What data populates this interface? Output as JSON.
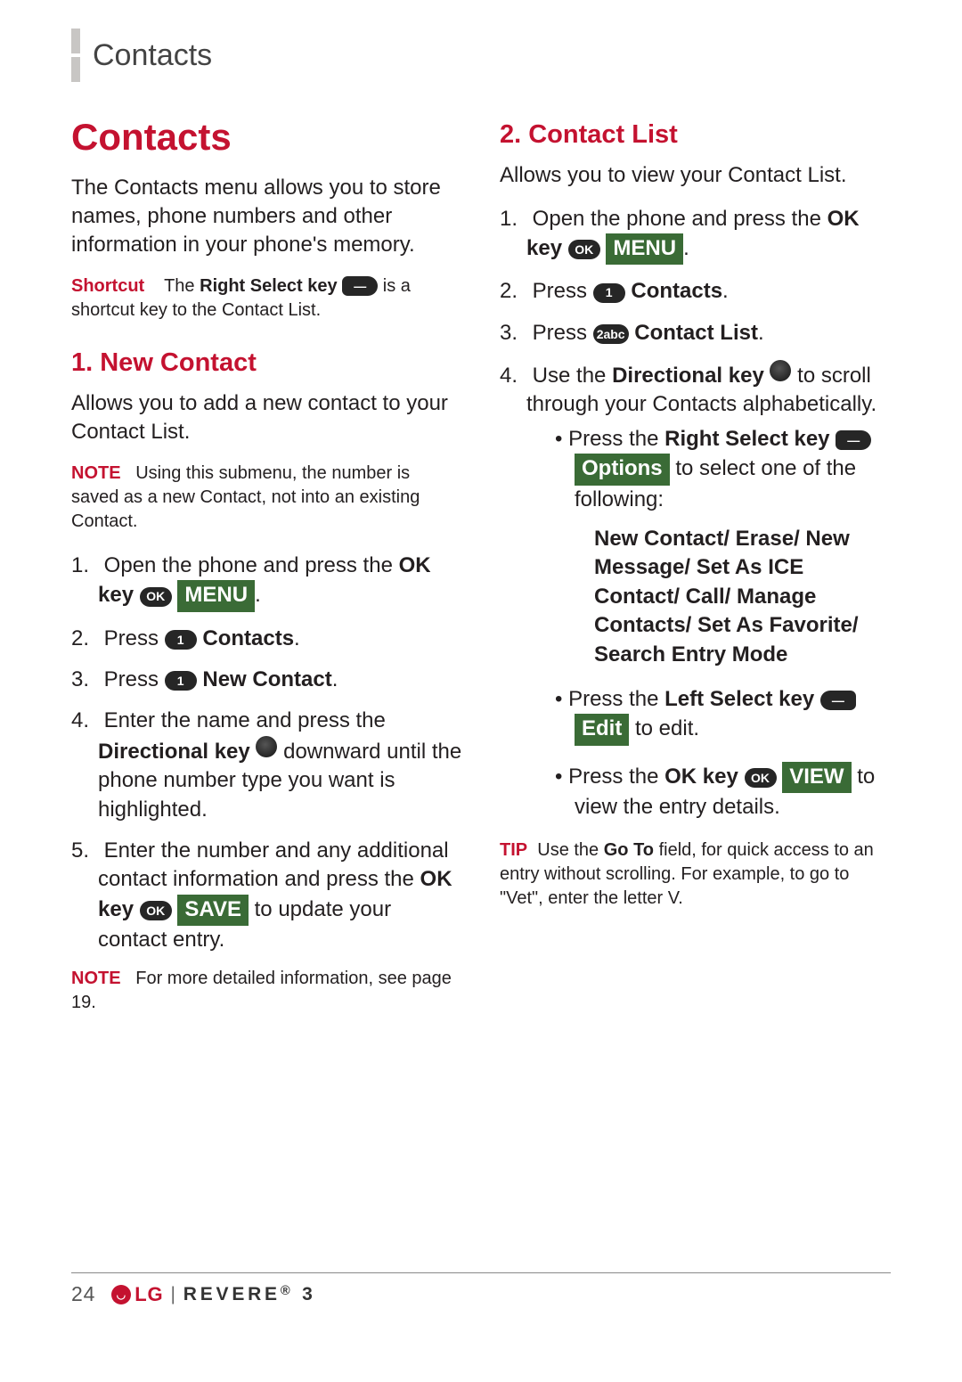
{
  "header": {
    "section": "Contacts"
  },
  "left": {
    "title": "Contacts",
    "intro": "The Contacts menu allows you to store names, phone numbers and other information in your phone's memory.",
    "shortcut_label": "Shortcut",
    "shortcut_a": "The ",
    "shortcut_b": "Right Select key",
    "shortcut_c": " is a shortcut key to the Contact List.",
    "h1": "1. New Contact",
    "h1_intro": "Allows you to add a new contact to your Contact List.",
    "note1_label": "NOTE",
    "note1": "Using this submenu, the number is saved as a new Contact, not into an existing Contact.",
    "s1a": "Open the phone and press the ",
    "ok_key": "OK key",
    "menu_label": "MENU",
    "s2a": "Press ",
    "contacts_label": "Contacts",
    "s3a": "Press ",
    "newcontact_label": "New Contact",
    "s4a": "Enter the name and press the ",
    "dir_key": "Directional key",
    "s4b": " downward until the phone number type you want is highlighted.",
    "s5a": "Enter the number and any additional contact information and press the ",
    "save_label": "SAVE",
    "s5b": " to update your contact entry.",
    "note2_label": "NOTE",
    "note2": "For more detailed information, see page 19."
  },
  "right": {
    "h2": "2. Contact List",
    "intro": "Allows you to view your Contact List.",
    "s1a": "Open the phone and press the ",
    "s2a": "Press ",
    "contacts_label": "Contacts",
    "s3a": "Press ",
    "contactlist_label": "Contact List",
    "s4a": "Use the ",
    "s4b": " to scroll through your Contacts alphabetically.",
    "b1a": "Press the ",
    "b1key": "Right Select key",
    "options_label": "Options",
    "b1b": " to select one of the following:",
    "options_block": "New Contact/ Erase/ New Message/ Set As ICE Contact/ Call/  Manage Contacts/ Set As Favorite/ Search Entry Mode",
    "b2a": "Press the ",
    "b2key": "Left Select key",
    "edit_label": "Edit",
    "b2b": " to edit.",
    "b3a": "Press the ",
    "b3key": "OK key",
    "view_label": "VIEW",
    "b3b": " to view the entry details.",
    "tip_label": "TIP",
    "tip_a": "Use the ",
    "tip_b": "Go To",
    "tip_c": " field, for quick access to an entry without scrolling. For example, to go to \"Vet\", enter the letter V."
  },
  "icons": {
    "ok": "OK",
    "one": "1",
    "two": "2abc",
    "dash": "—"
  },
  "footer": {
    "page": "24",
    "brand": "LG",
    "model": "REVERE",
    "model_suffix": "3"
  }
}
